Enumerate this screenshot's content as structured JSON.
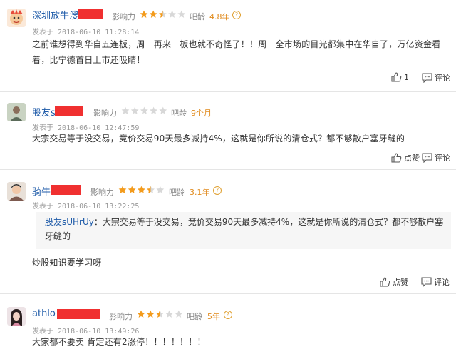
{
  "labels": {
    "influence": "影响力",
    "age": "吧龄",
    "posted": "发表于",
    "like": "点赞",
    "comment": "评论"
  },
  "colors": {
    "username": "#1d5aa8",
    "age": "#e08a1c",
    "star": "#f39b1c",
    "star_empty": "#d8d8d8",
    "redaction": "#f03030"
  },
  "posts": [
    {
      "username": "深圳放牛溲",
      "rating": 2.5,
      "age": "4.8年",
      "time": "2018-06-10 11:28:14",
      "content": "之前谁想得到华自五连板，周一再来一板也就不奇怪了！！周一全市场的目光都集中在华自了，万亿资金看着，比宁德首日上市还吸睛！",
      "like_label": "1",
      "comment_label": "评论"
    },
    {
      "username": "股友s",
      "rating": 0,
      "age": "9个月",
      "time": "2018-06-10 12:47:59",
      "content": "大宗交易等于没交易，竞价交易90天最多减持4%，这就是你所说的清仓式？都不够散户塞牙缝的",
      "like_label": "点赞",
      "comment_label": "评论"
    },
    {
      "username": "骑牛",
      "rating": 3.5,
      "age": "3.1年",
      "time": "2018-06-10 13:22:25",
      "quote_user": "股友sUHrUy",
      "quote_text": "：大宗交易等于没交易，竞价交易90天最多减持4%，这就是你所说的清仓式？都不够散户塞牙缝的",
      "content": "炒股知识要学习呀",
      "like_label": "点赞",
      "comment_label": "评论"
    },
    {
      "username": "athlo",
      "rating": 2.5,
      "age": "5年",
      "time": "2018-06-10 13:49:26",
      "content": "大家都不要卖 肯定还有2涨停！！！！！！！"
    }
  ]
}
